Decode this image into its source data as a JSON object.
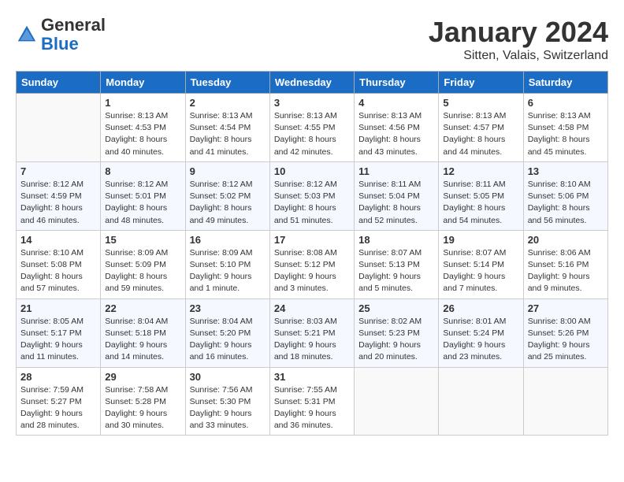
{
  "header": {
    "logo_general": "General",
    "logo_blue": "Blue",
    "month_title": "January 2024",
    "location": "Sitten, Valais, Switzerland"
  },
  "weekdays": [
    "Sunday",
    "Monday",
    "Tuesday",
    "Wednesday",
    "Thursday",
    "Friday",
    "Saturday"
  ],
  "weeks": [
    [
      {
        "day": "",
        "info": ""
      },
      {
        "day": "1",
        "info": "Sunrise: 8:13 AM\nSunset: 4:53 PM\nDaylight: 8 hours\nand 40 minutes."
      },
      {
        "day": "2",
        "info": "Sunrise: 8:13 AM\nSunset: 4:54 PM\nDaylight: 8 hours\nand 41 minutes."
      },
      {
        "day": "3",
        "info": "Sunrise: 8:13 AM\nSunset: 4:55 PM\nDaylight: 8 hours\nand 42 minutes."
      },
      {
        "day": "4",
        "info": "Sunrise: 8:13 AM\nSunset: 4:56 PM\nDaylight: 8 hours\nand 43 minutes."
      },
      {
        "day": "5",
        "info": "Sunrise: 8:13 AM\nSunset: 4:57 PM\nDaylight: 8 hours\nand 44 minutes."
      },
      {
        "day": "6",
        "info": "Sunrise: 8:13 AM\nSunset: 4:58 PM\nDaylight: 8 hours\nand 45 minutes."
      }
    ],
    [
      {
        "day": "7",
        "info": "Sunrise: 8:12 AM\nSunset: 4:59 PM\nDaylight: 8 hours\nand 46 minutes."
      },
      {
        "day": "8",
        "info": "Sunrise: 8:12 AM\nSunset: 5:01 PM\nDaylight: 8 hours\nand 48 minutes."
      },
      {
        "day": "9",
        "info": "Sunrise: 8:12 AM\nSunset: 5:02 PM\nDaylight: 8 hours\nand 49 minutes."
      },
      {
        "day": "10",
        "info": "Sunrise: 8:12 AM\nSunset: 5:03 PM\nDaylight: 8 hours\nand 51 minutes."
      },
      {
        "day": "11",
        "info": "Sunrise: 8:11 AM\nSunset: 5:04 PM\nDaylight: 8 hours\nand 52 minutes."
      },
      {
        "day": "12",
        "info": "Sunrise: 8:11 AM\nSunset: 5:05 PM\nDaylight: 8 hours\nand 54 minutes."
      },
      {
        "day": "13",
        "info": "Sunrise: 8:10 AM\nSunset: 5:06 PM\nDaylight: 8 hours\nand 56 minutes."
      }
    ],
    [
      {
        "day": "14",
        "info": "Sunrise: 8:10 AM\nSunset: 5:08 PM\nDaylight: 8 hours\nand 57 minutes."
      },
      {
        "day": "15",
        "info": "Sunrise: 8:09 AM\nSunset: 5:09 PM\nDaylight: 8 hours\nand 59 minutes."
      },
      {
        "day": "16",
        "info": "Sunrise: 8:09 AM\nSunset: 5:10 PM\nDaylight: 9 hours\nand 1 minute."
      },
      {
        "day": "17",
        "info": "Sunrise: 8:08 AM\nSunset: 5:12 PM\nDaylight: 9 hours\nand 3 minutes."
      },
      {
        "day": "18",
        "info": "Sunrise: 8:07 AM\nSunset: 5:13 PM\nDaylight: 9 hours\nand 5 minutes."
      },
      {
        "day": "19",
        "info": "Sunrise: 8:07 AM\nSunset: 5:14 PM\nDaylight: 9 hours\nand 7 minutes."
      },
      {
        "day": "20",
        "info": "Sunrise: 8:06 AM\nSunset: 5:16 PM\nDaylight: 9 hours\nand 9 minutes."
      }
    ],
    [
      {
        "day": "21",
        "info": "Sunrise: 8:05 AM\nSunset: 5:17 PM\nDaylight: 9 hours\nand 11 minutes."
      },
      {
        "day": "22",
        "info": "Sunrise: 8:04 AM\nSunset: 5:18 PM\nDaylight: 9 hours\nand 14 minutes."
      },
      {
        "day": "23",
        "info": "Sunrise: 8:04 AM\nSunset: 5:20 PM\nDaylight: 9 hours\nand 16 minutes."
      },
      {
        "day": "24",
        "info": "Sunrise: 8:03 AM\nSunset: 5:21 PM\nDaylight: 9 hours\nand 18 minutes."
      },
      {
        "day": "25",
        "info": "Sunrise: 8:02 AM\nSunset: 5:23 PM\nDaylight: 9 hours\nand 20 minutes."
      },
      {
        "day": "26",
        "info": "Sunrise: 8:01 AM\nSunset: 5:24 PM\nDaylight: 9 hours\nand 23 minutes."
      },
      {
        "day": "27",
        "info": "Sunrise: 8:00 AM\nSunset: 5:26 PM\nDaylight: 9 hours\nand 25 minutes."
      }
    ],
    [
      {
        "day": "28",
        "info": "Sunrise: 7:59 AM\nSunset: 5:27 PM\nDaylight: 9 hours\nand 28 minutes."
      },
      {
        "day": "29",
        "info": "Sunrise: 7:58 AM\nSunset: 5:28 PM\nDaylight: 9 hours\nand 30 minutes."
      },
      {
        "day": "30",
        "info": "Sunrise: 7:56 AM\nSunset: 5:30 PM\nDaylight: 9 hours\nand 33 minutes."
      },
      {
        "day": "31",
        "info": "Sunrise: 7:55 AM\nSunset: 5:31 PM\nDaylight: 9 hours\nand 36 minutes."
      },
      {
        "day": "",
        "info": ""
      },
      {
        "day": "",
        "info": ""
      },
      {
        "day": "",
        "info": ""
      }
    ]
  ]
}
